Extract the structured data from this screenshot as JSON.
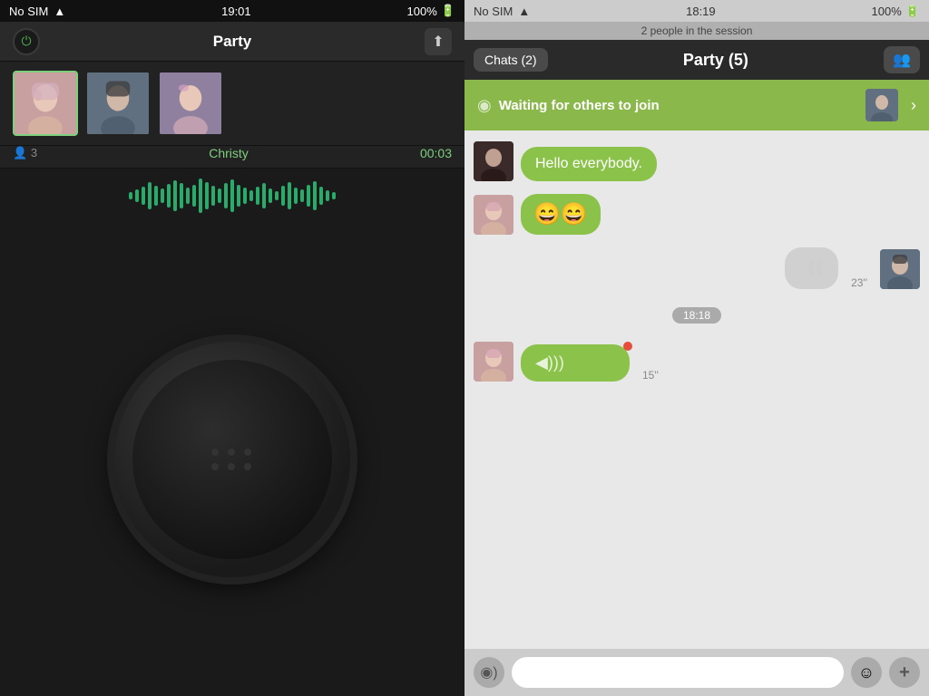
{
  "left": {
    "statusBar": {
      "carrier": "No SIM",
      "time": "19:01",
      "battery": "100%"
    },
    "header": {
      "title": "Party",
      "powerIcon": "⏻",
      "uploadIcon": "⬆"
    },
    "participants": [
      {
        "id": 1,
        "name": "Christy",
        "active": true,
        "cssClass": "thumb-1"
      },
      {
        "id": 2,
        "name": "Male user",
        "active": false,
        "cssClass": "thumb-2"
      },
      {
        "id": 3,
        "name": "Female user 2",
        "active": false,
        "cssClass": "thumb-3"
      }
    ],
    "info": {
      "peopleCount": "3",
      "speakerName": "Christy",
      "timer": "00:03"
    }
  },
  "right": {
    "statusBar": {
      "carrier": "No SIM",
      "time": "18:19",
      "battery": "100%"
    },
    "sessionInfo": "2 people in the session",
    "header": {
      "chatsLabel": "Chats (2)",
      "partyTitle": "Party  (5)",
      "peopleIcon": "👥"
    },
    "waitingBanner": {
      "text": "Waiting for others to join"
    },
    "messages": [
      {
        "id": 1,
        "sender": "left",
        "avatarClass": "av1",
        "text": "Hello everybody.",
        "type": "text"
      },
      {
        "id": 2,
        "sender": "left",
        "avatarClass": "av2",
        "text": "😄😄",
        "type": "emoji"
      },
      {
        "id": 3,
        "sender": "right",
        "avatarClass": "av3",
        "time": "23''",
        "type": "audio"
      },
      {
        "id": 4,
        "timestamp": "18:18"
      },
      {
        "id": 5,
        "sender": "left",
        "avatarClass": "av2",
        "time": "15''",
        "type": "audio-recording"
      }
    ],
    "inputBar": {
      "placeholder": ""
    }
  }
}
